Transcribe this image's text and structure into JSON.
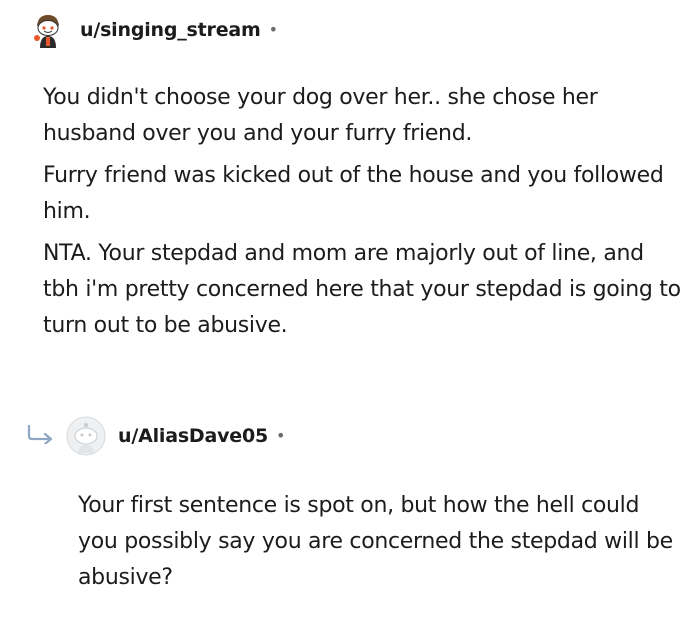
{
  "comment": {
    "username": "u/singing_stream",
    "separator": "•",
    "paragraphs": [
      "You didn't choose your dog over her.. she chose her husband over you and your furry friend.",
      "Furry friend was kicked out of the house and you followed him.",
      "NTA. Your stepdad and mom are majorly out of line, and tbh i'm pretty concerned here that your stepdad is going to turn out to be abusive."
    ]
  },
  "reply": {
    "username": "u/AliasDave05",
    "separator": "•",
    "paragraphs": [
      "Your first sentence is spot on, but how the hell could you possibly say you are concerned the stepdad will be abusive?"
    ]
  },
  "icons": {
    "avatar_main": "snoo-avatar-icon",
    "avatar_reply": "default-avatar-icon",
    "reply_arrow": "reply-arrow-icon"
  },
  "colors": {
    "text": "#1c1c1c",
    "meta": "#6b6b6b",
    "reply_arrow": "#8ea7c3",
    "avatar_placeholder": "#d7dadc"
  }
}
